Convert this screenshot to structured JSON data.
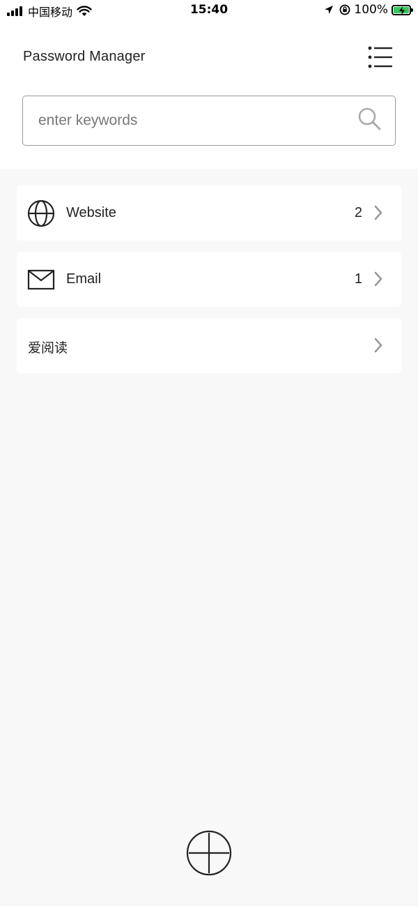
{
  "status_bar": {
    "carrier": "中国移动",
    "time": "15:40",
    "battery": "100%"
  },
  "header": {
    "title": "Password Manager",
    "menu_icon": "list-menu-icon"
  },
  "search": {
    "placeholder": "enter keywords",
    "value": "",
    "icon": "search-icon"
  },
  "categories": [
    {
      "label": "Website",
      "count": "2",
      "icon": "globe-icon"
    },
    {
      "label": "Email",
      "count": "1",
      "icon": "envelope-icon"
    },
    {
      "label": "爱阅读",
      "count": "",
      "icon": ""
    }
  ],
  "fab": {
    "icon": "plus-circle-icon"
  },
  "colors": {
    "background": "#f8f8f8",
    "card": "#ffffff",
    "text": "#222222",
    "muted": "#9a9a9a",
    "battery": "#34c759"
  }
}
